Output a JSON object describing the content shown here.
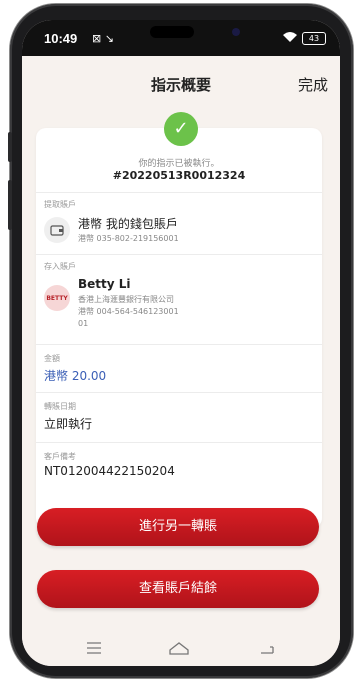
{
  "status": {
    "time": "10:49",
    "left_icons": "⊠ ↘",
    "battery": "43"
  },
  "header": {
    "title": "指示概要",
    "done_label": "完成"
  },
  "confirmation": {
    "executed_text": "你的指示已被執行。",
    "reference": "#20220513R0012324"
  },
  "from_account": {
    "label": "提取賬戶",
    "name": "港幣 我的錢包賬戶",
    "number": "港幣 035-802-219156001"
  },
  "to_account": {
    "label": "存入賬戶",
    "avatar_text": "BETTY",
    "name": "Betty Li",
    "bank": "香港上海滙豐銀行有限公司",
    "number": "港幣 004-564-546123001",
    "suffix": "01"
  },
  "amount": {
    "label": "金額",
    "value": "港幣 20.00"
  },
  "transfer_date": {
    "label": "轉賬日期",
    "value": "立即執行"
  },
  "customer_ref": {
    "label": "客戶備考",
    "value": "NT012004422150204"
  },
  "buttons": {
    "another_transfer": "進行另一轉賬",
    "view_balance": "查看賬戶結餘"
  },
  "colors": {
    "accent": "#d81e24",
    "success": "#6cc24a",
    "amount": "#3b5fb6",
    "background": "#f7f2ee"
  },
  "icons": [
    "wallet-icon",
    "check-icon",
    "menu-icon",
    "home-icon",
    "back-icon"
  ]
}
